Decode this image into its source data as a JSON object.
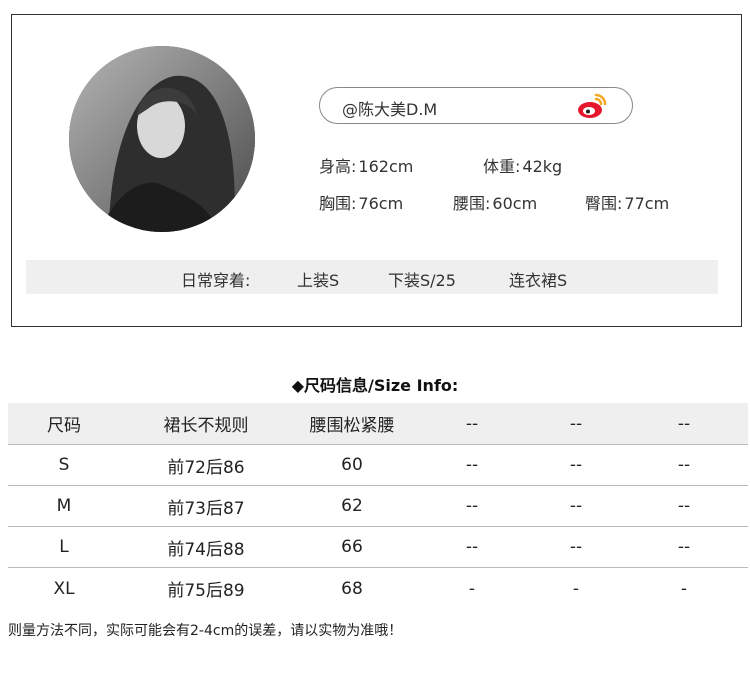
{
  "profile": {
    "weibo_handle": "@陈大美D.M",
    "height": {
      "label": "身高:",
      "value": "162cm"
    },
    "weight": {
      "label": "体重:",
      "value": "42kg"
    },
    "bust": {
      "label": "胸围:",
      "value": "76cm"
    },
    "waist": {
      "label": "腰围:",
      "value": "60cm"
    },
    "hip": {
      "label": "臀围:",
      "value": "77cm"
    },
    "daily_wear": {
      "label": "日常穿着:",
      "top": "上装S",
      "bottom": "下装S/25",
      "dress": "连衣裙S"
    }
  },
  "size_info": {
    "title": "◆尺码信息/Size Info:",
    "headers": [
      "尺码",
      "裙长不规则",
      "腰围松紧腰",
      "--",
      "--",
      "--"
    ],
    "rows": [
      [
        "S",
        "前72后86",
        "60",
        "--",
        "--",
        "--"
      ],
      [
        "M",
        "前73后87",
        "62",
        "--",
        "--",
        "--"
      ],
      [
        "L",
        "前74后88",
        "66",
        "--",
        "--",
        "--"
      ],
      [
        "XL",
        "前75后89",
        "68",
        "-",
        "-",
        "-"
      ]
    ]
  },
  "footnote": "则量方法不同，实际可能会有2-4cm的误差，请以实物为准哦！",
  "icons": {
    "weibo": "weibo-icon",
    "avatar": "avatar"
  },
  "colors": {
    "weibo_red": "#e6162d",
    "weibo_orange": "#f5a623",
    "bar_bg": "#efefef"
  }
}
